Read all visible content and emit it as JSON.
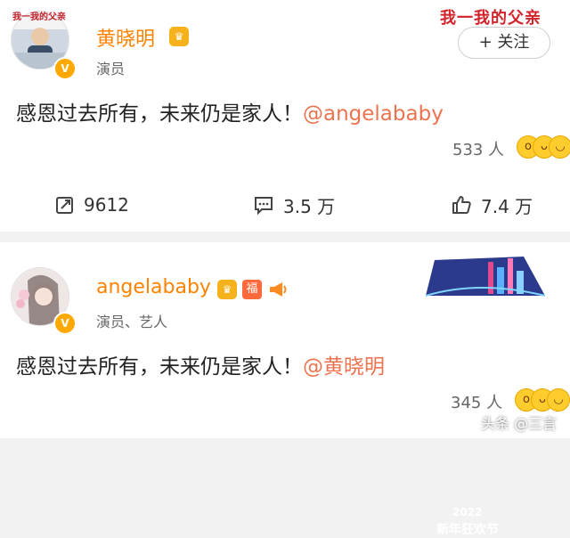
{
  "posts": [
    {
      "author": "黄晓明",
      "subtitle": "演员",
      "avatar_text": "我一我的父亲",
      "banner_text": "我一我的父亲",
      "follow_label": "+ 关注",
      "content_text": "感恩过去所有，未来仍是家人！",
      "content_mention": "@angelababy",
      "reaction_count": "533 人",
      "actions": {
        "reposts": "9612",
        "comments": "3.5 万",
        "likes": "7.4 万"
      }
    },
    {
      "author": "angelababy",
      "subtitle": "演员、艺人",
      "banner_year": "2022",
      "banner_text": "新年狂欢节",
      "badge_text": "福",
      "content_text": "感恩过去所有，未来仍是家人！",
      "content_mention": "@黄晓明",
      "reaction_count": "345 人"
    }
  ],
  "watermark": "头条 @三言",
  "colors": {
    "name": "#ff8200",
    "mention": "#eb7350",
    "verified": "#ffa800"
  }
}
